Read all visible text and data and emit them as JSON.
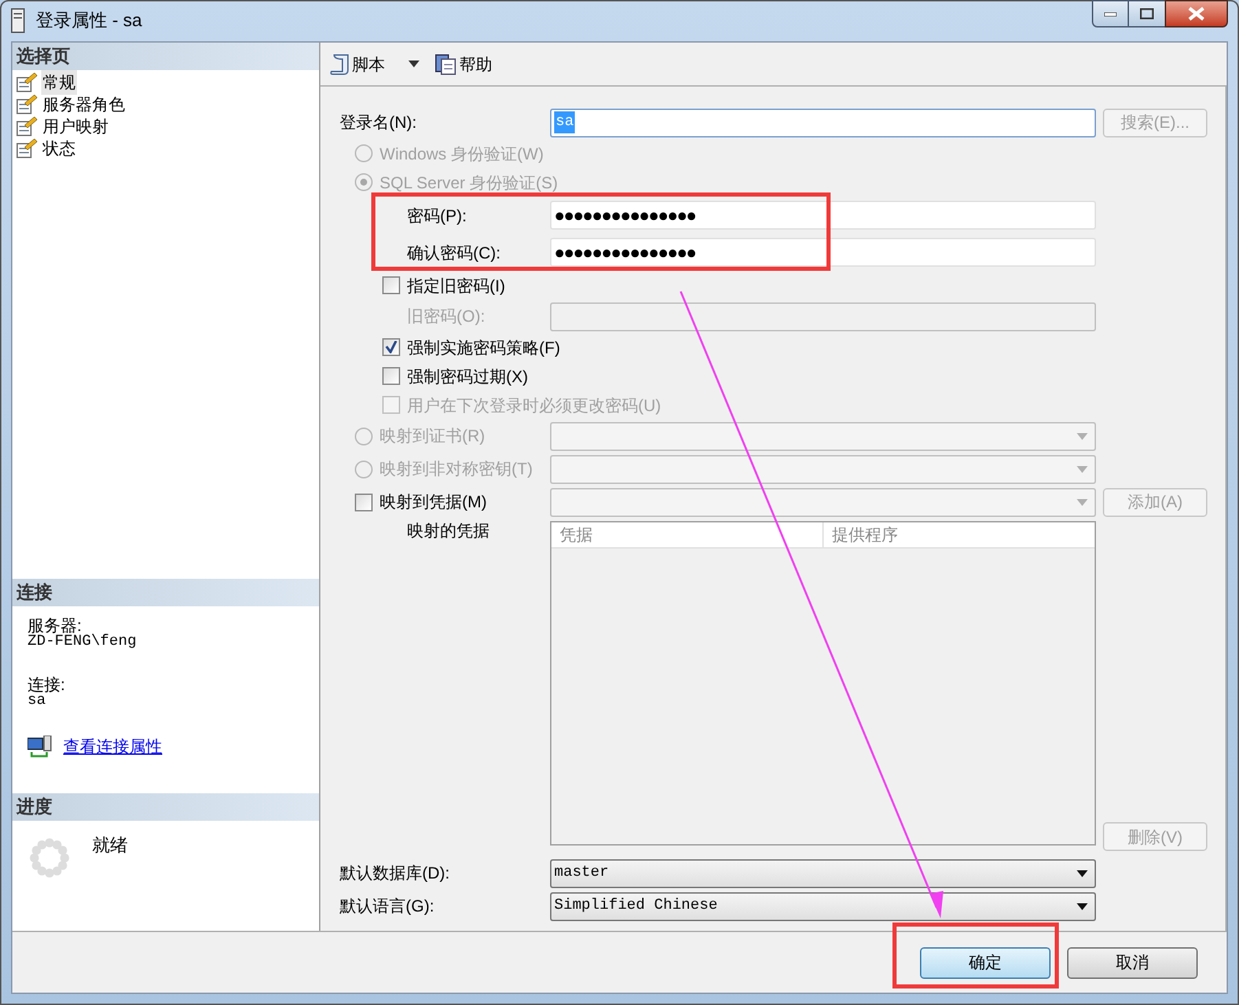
{
  "window": {
    "title": "登录属性 - sa"
  },
  "sidebar": {
    "select_page": {
      "header": "选择页",
      "items": [
        {
          "label": "常规",
          "selected": true
        },
        {
          "label": "服务器角色",
          "selected": false
        },
        {
          "label": "用户映射",
          "selected": false
        },
        {
          "label": "状态",
          "selected": false
        }
      ]
    },
    "connection": {
      "header": "连接",
      "server_label": "服务器:",
      "server": "ZD-FENG\\feng",
      "connection_label": "连接:",
      "connection": "sa",
      "link": "查看连接属性"
    },
    "progress": {
      "header": "进度",
      "status": "就绪"
    }
  },
  "toolbar": [
    {
      "label": "脚本",
      "kind": "script"
    },
    {
      "label": "帮助",
      "kind": "help"
    }
  ],
  "form": {
    "rows": [
      {
        "kind": "text",
        "label": "登录名(N):",
        "value": "sa",
        "disabled": false,
        "button": {
          "label": "搜索(E)...",
          "disabled": true
        }
      },
      {
        "kind": "radio",
        "label": "Windows 身份验证(W)",
        "selected": false,
        "disabled": true
      },
      {
        "kind": "radio",
        "label": "SQL Server 身份验证(S)",
        "selected": true,
        "disabled": true,
        "children": [
          {
            "kind": "password",
            "label": "密码(P):",
            "value": "●●●●●●●●●●●●●●●"
          },
          {
            "kind": "password",
            "label": "确认密码(C):",
            "value": "●●●●●●●●●●●●●●●"
          },
          {
            "kind": "checkbox",
            "label": "指定旧密码(I)",
            "checked": false,
            "disabled": false,
            "children": [
              {
                "kind": "text",
                "label": "旧密码(O):",
                "disabled": true
              }
            ]
          },
          {
            "kind": "checkbox",
            "label": "强制实施密码策略(F)",
            "checked": true,
            "disabled": false
          },
          {
            "kind": "checkbox",
            "label": "强制密码过期(X)",
            "checked": false,
            "disabled": false
          },
          {
            "kind": "checkbox",
            "label": "用户在下次登录时必须更改密码(U)",
            "checked": false,
            "disabled": true
          }
        ]
      },
      {
        "kind": "radio",
        "label": "映射到证书(R)",
        "selected": false,
        "disabled": true,
        "combo": {
          "disabled": true
        }
      },
      {
        "kind": "radio",
        "label": "映射到非对称密钥(T)",
        "selected": false,
        "disabled": true,
        "combo": {
          "disabled": true
        }
      },
      {
        "kind": "checkbox",
        "label": "映射到凭据(M)",
        "checked": false,
        "disabled": false,
        "combo": {
          "disabled": true
        },
        "button": {
          "label": "添加(A)",
          "disabled": true
        },
        "children": [
          {
            "kind": "table",
            "label": "映射的凭据",
            "columns": [
              "凭据",
              "提供程序"
            ],
            "button": {
              "label": "删除(V)",
              "disabled": true
            }
          }
        ]
      },
      {
        "kind": "combo",
        "label": "默认数据库(D):",
        "value": "master",
        "combo": {
          "disabled": false
        }
      },
      {
        "kind": "combo",
        "label": "默认语言(G):",
        "value": "Simplified Chinese",
        "combo": {
          "disabled": false
        }
      }
    ]
  },
  "buttons": [
    {
      "label": "确定",
      "default": true
    },
    {
      "label": "取消",
      "default": false
    }
  ]
}
